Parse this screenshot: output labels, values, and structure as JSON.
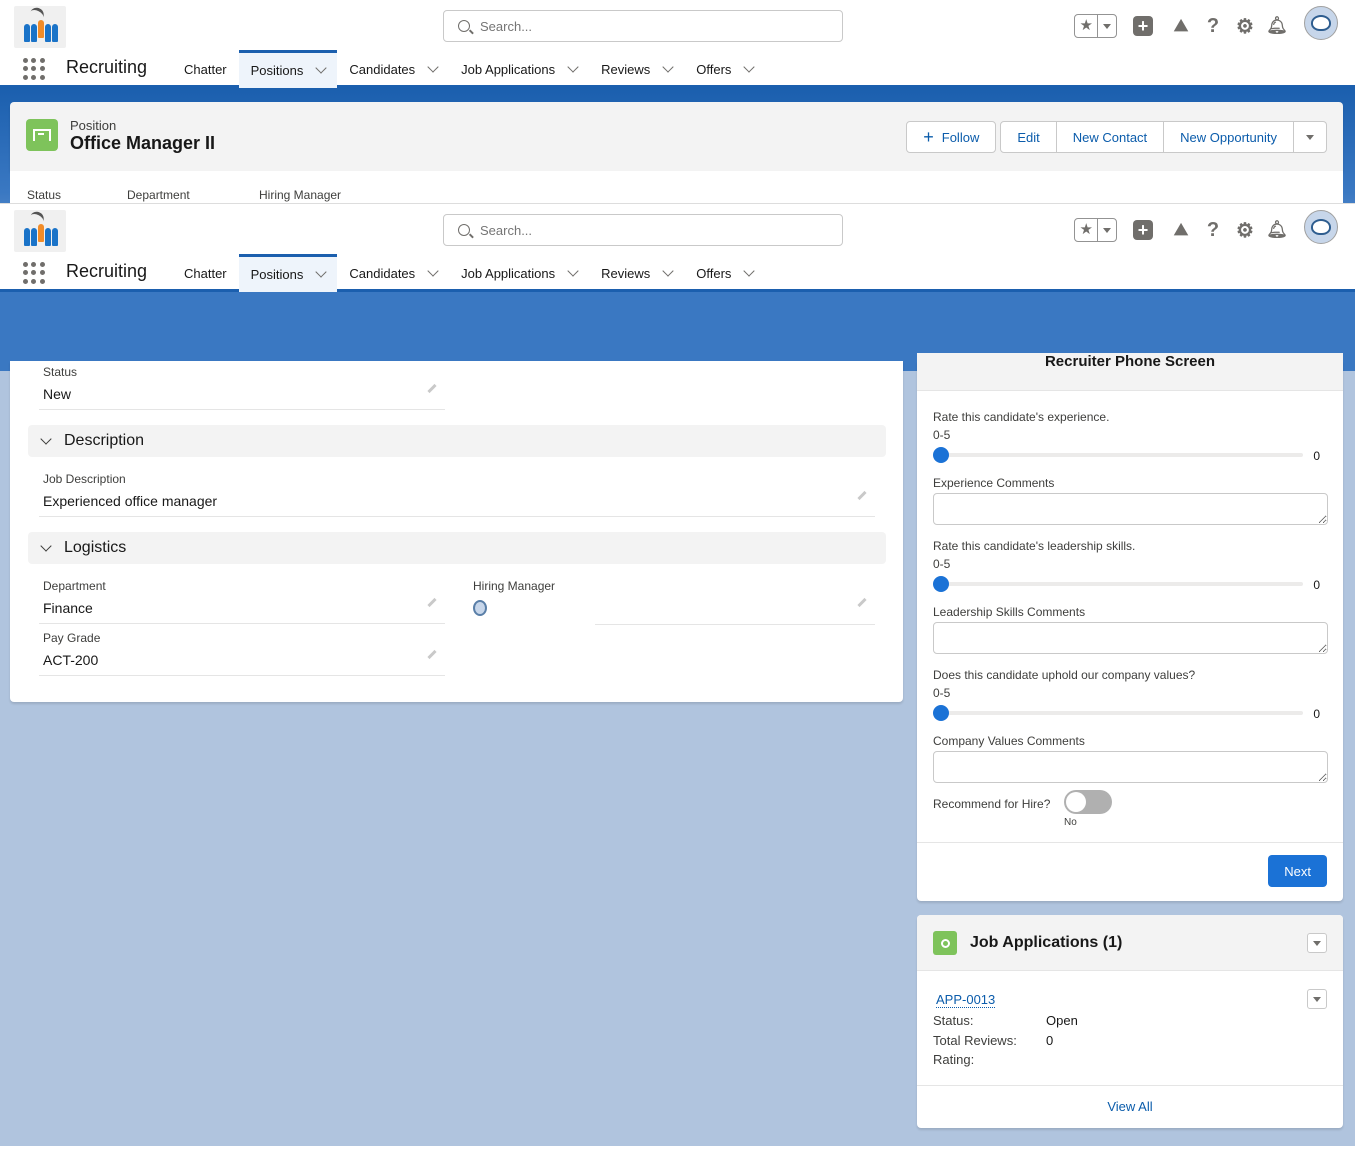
{
  "app": {
    "name": "Recruiting",
    "logo_icon": "recruiting-people-logo"
  },
  "search": {
    "placeholder": "Search..."
  },
  "utility_icons": [
    "favorites-star-icon",
    "global-actions-plus-icon",
    "trailhead-guide-icon",
    "help-icon",
    "setup-gear-icon",
    "notifications-bell-icon",
    "user-avatar"
  ],
  "nav": {
    "tabs": [
      {
        "label": "Chatter",
        "has_menu": false,
        "active": false
      },
      {
        "label": "Positions",
        "has_menu": true,
        "active": true
      },
      {
        "label": "Candidates",
        "has_menu": true,
        "active": false
      },
      {
        "label": "Job Applications",
        "has_menu": true,
        "active": false
      },
      {
        "label": "Reviews",
        "has_menu": true,
        "active": false
      },
      {
        "label": "Offers",
        "has_menu": true,
        "active": false
      }
    ]
  },
  "record": {
    "object_label": "Position",
    "name": "Office Manager II",
    "actions": {
      "follow": "Follow",
      "edit": "Edit",
      "new_contact": "New Contact",
      "new_opportunity": "New Opportunity"
    },
    "compact_fields": [
      "Status",
      "Department",
      "Hiring Manager"
    ]
  },
  "details": {
    "status": {
      "label": "Status",
      "value": "New"
    },
    "sections": {
      "description": "Description",
      "logistics": "Logistics"
    },
    "job_description": {
      "label": "Job Description",
      "value": "Experienced office manager"
    },
    "department": {
      "label": "Department",
      "value": "Finance"
    },
    "hiring_manager": {
      "label": "Hiring Manager",
      "value": ""
    },
    "pay_grade": {
      "label": "Pay Grade",
      "value": "ACT-200"
    }
  },
  "flow": {
    "title": "Recruiter Phone Screen",
    "questions": [
      {
        "question": "Rate this candidate's experience.",
        "range": "0-5",
        "value": 0,
        "min": 0,
        "max": 5,
        "comment_label": "Experience Comments",
        "comment_value": ""
      },
      {
        "question": "Rate this candidate's leadership skills.",
        "range": "0-5",
        "value": 0,
        "min": 0,
        "max": 5,
        "comment_label": "Leadership Skills Comments",
        "comment_value": ""
      },
      {
        "question": "Does this candidate uphold our company values?",
        "range": "0-5",
        "value": 0,
        "min": 0,
        "max": 5,
        "comment_label": "Company Values Comments",
        "comment_value": ""
      }
    ],
    "recommend": {
      "label": "Recommend for Hire?",
      "state": "No",
      "checked": false
    },
    "next_label": "Next"
  },
  "related": {
    "title": "Job Applications (1)",
    "record": {
      "name": "APP-0013",
      "fields": [
        {
          "label": "Status:",
          "value": "Open"
        },
        {
          "label": "Total Reviews:",
          "value": "0"
        },
        {
          "label": "Rating:",
          "value": ""
        }
      ]
    },
    "view_all": "View All"
  },
  "colors": {
    "brand_blue": "#1b5fae",
    "link_blue": "#0b5cab",
    "button_blue": "#1b72d6",
    "object_green": "#7ec35b",
    "page_bg": "#b0c4de"
  }
}
